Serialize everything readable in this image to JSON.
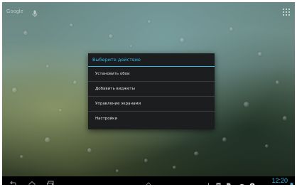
{
  "search_bar": {
    "brand": "Google",
    "mic_icon": "microphone-icon"
  },
  "dialog": {
    "title": "Выберите действие",
    "items": [
      {
        "label": "Установить обои"
      },
      {
        "label": "Добавить виджеты"
      },
      {
        "label": "Управление экранами"
      },
      {
        "label": "Настройки"
      }
    ]
  },
  "system_bar": {
    "nav_icons": [
      "back-icon",
      "home-icon",
      "recent-apps-icon",
      "menu-up-icon"
    ],
    "notification_icons": [
      "usb-icon",
      "gallery-icon",
      "sd-card-icon",
      "wifi-icon",
      "info-icon"
    ],
    "clock": "12:20"
  },
  "colors": {
    "accent": "#33b5e5",
    "dialog_bg": "#1c1d1f",
    "system_bar_bg": "#000000"
  }
}
